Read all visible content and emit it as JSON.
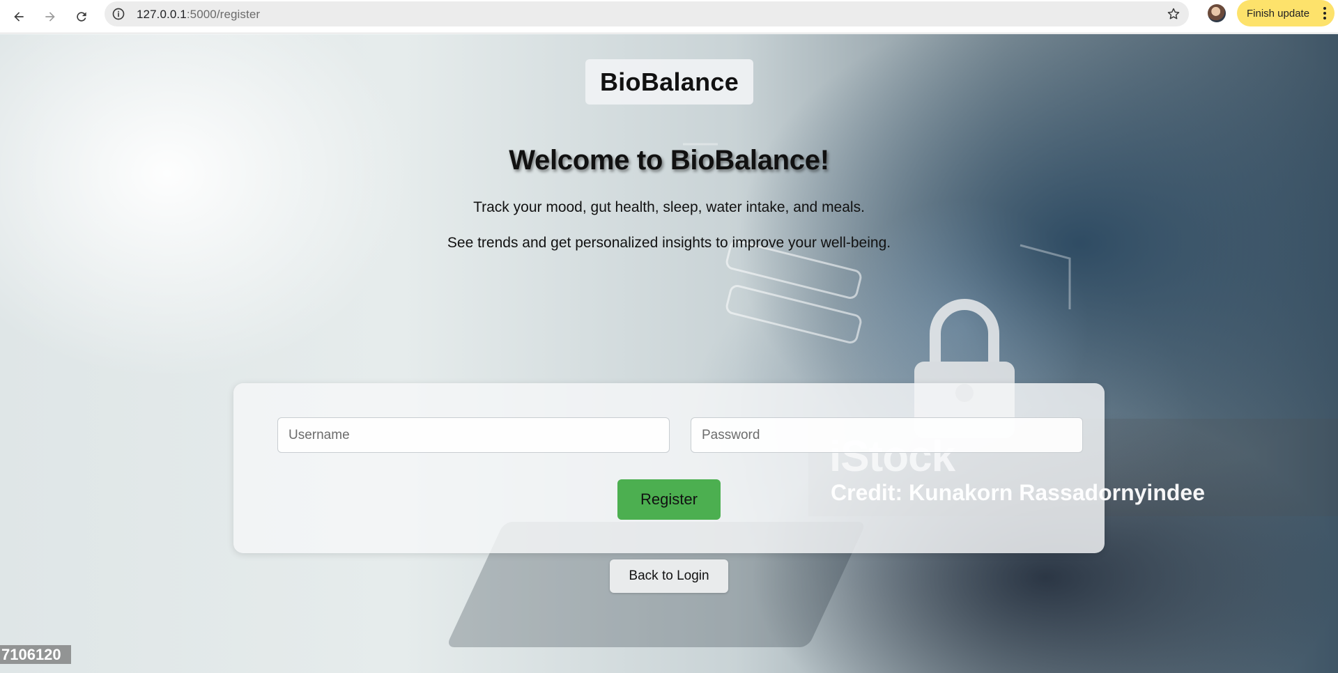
{
  "browser": {
    "url_host": "127.0.0.1",
    "url_path": ":5000/register",
    "update_label": "Finish update",
    "icons": {
      "back": "back-arrow-icon",
      "forward": "forward-arrow-icon",
      "reload": "reload-icon",
      "info": "info-icon",
      "star": "star-icon",
      "menu": "kebab-menu-icon"
    }
  },
  "header": {
    "brand": "BioBalance"
  },
  "hero": {
    "title": "Welcome to BioBalance!",
    "line1": "Track your mood, gut health, sleep, water intake, and meals.",
    "line2": "See trends and get personalized insights to improve your well-being."
  },
  "form": {
    "username_placeholder": "Username",
    "password_placeholder": "Password",
    "register_label": "Register",
    "accent_color": "#4caf50"
  },
  "back_label": "Back to Login",
  "watermark": {
    "brand": "iStock",
    "credit": "Credit: Kunakorn Rassadornyindee",
    "image_id_fragment": "7106120"
  }
}
